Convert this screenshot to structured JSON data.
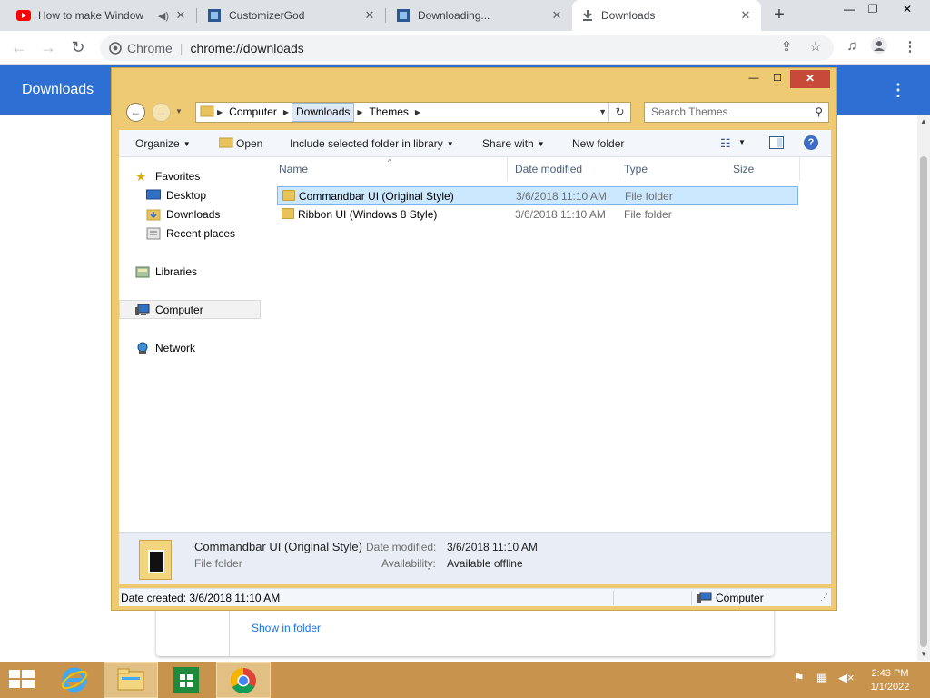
{
  "browser": {
    "tabs": [
      {
        "title": "How to make Window",
        "icon": "youtube-icon",
        "icon_color": "#ff0000",
        "audio_icon": "speaker-icon",
        "active": false
      },
      {
        "title": "CustomizerGod",
        "icon": "customizergod-icon",
        "icon_color": "#2b5797",
        "active": false
      },
      {
        "title": "Downloading...",
        "icon": "customizergod-icon",
        "icon_color": "#2b5797",
        "active": false
      },
      {
        "title": "Downloads",
        "icon": "download-icon",
        "icon_color": "#5f6368",
        "active": true
      }
    ],
    "close_glyph": "✕",
    "new_tab_glyph": "+",
    "window_controls": [
      "—",
      "❐",
      "✕"
    ],
    "omnibox": {
      "site_label": "Chrome",
      "url": "chrome://downloads"
    },
    "page": {
      "title": "Downloads",
      "menu_glyph": "⋮",
      "show_in_folder": "Show in folder",
      "header_color": "#2d6fd2"
    }
  },
  "explorer": {
    "window_controls": [
      "—",
      "☐",
      "✕"
    ],
    "breadcrumbs": [
      "Computer",
      "Downloads",
      "Themes"
    ],
    "search_placeholder": "Search Themes",
    "commands": [
      {
        "label": "Organize",
        "has_dropdown": true
      },
      {
        "label": "Open",
        "has_dropdown": false
      },
      {
        "label": "Include selected folder in library",
        "has_dropdown": true
      },
      {
        "label": "Share with",
        "has_dropdown": true
      },
      {
        "label": "New folder",
        "has_dropdown": false
      }
    ],
    "nav": {
      "favorites": {
        "label": "Favorites",
        "items": [
          "Desktop",
          "Downloads",
          "Recent places"
        ]
      },
      "libraries": "Libraries",
      "computer": "Computer",
      "network": "Network"
    },
    "columns": [
      "Name",
      "Date modified",
      "Type",
      "Size"
    ],
    "files": [
      {
        "name": "Commandbar UI (Original Style)",
        "date": "3/6/2018 11:10 AM",
        "type": "File folder",
        "size": "",
        "selected": true
      },
      {
        "name": "Ribbon UI (Windows 8 Style)",
        "date": "3/6/2018 11:10 AM",
        "type": "File folder",
        "size": "",
        "selected": false
      }
    ],
    "details": {
      "name": "Commandbar UI (Original Style)",
      "kind": "File folder",
      "date_label": "Date modified:",
      "date_value": "3/6/2018 11:10 AM",
      "availability_label": "Availability:",
      "availability_value": "Available offline"
    },
    "status": {
      "left": "Date created: 3/6/2018 11:10 AM",
      "right": "Computer"
    },
    "frame_color": "#eeca73"
  },
  "taskbar": {
    "color": "#c8934d",
    "apps": [
      "start-button",
      "internet-explorer",
      "file-explorer",
      "store",
      "chrome"
    ],
    "clock_time": "2:43 PM",
    "clock_date": "1/1/2022"
  }
}
